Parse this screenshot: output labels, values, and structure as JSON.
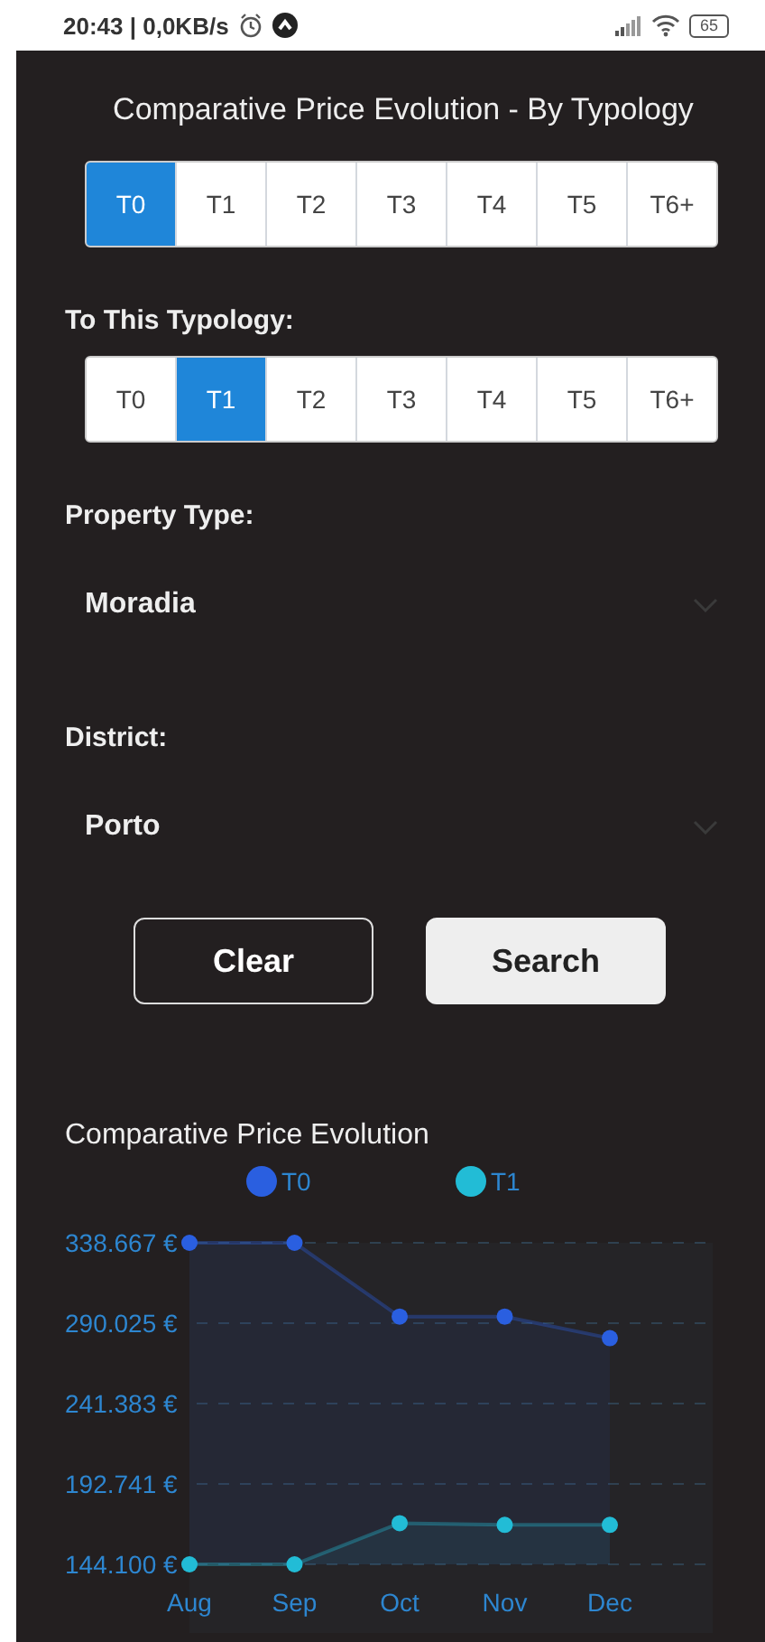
{
  "status_bar": {
    "text": "20:43 | 0,0KB/s",
    "battery": "65"
  },
  "title": "Comparative Price Evolution - By Typology",
  "from_typology": {
    "options": [
      {
        "label": "T0",
        "selected": true
      },
      {
        "label": "T1",
        "selected": false
      },
      {
        "label": "T2",
        "selected": false
      },
      {
        "label": "T3",
        "selected": false
      },
      {
        "label": "T4",
        "selected": false
      },
      {
        "label": "T5",
        "selected": false
      },
      {
        "label": "T6+",
        "selected": false
      }
    ]
  },
  "to_typology": {
    "label": "To This Typology:",
    "options": [
      {
        "label": "T0",
        "selected": false
      },
      {
        "label": "T1",
        "selected": true
      },
      {
        "label": "T2",
        "selected": false
      },
      {
        "label": "T3",
        "selected": false
      },
      {
        "label": "T4",
        "selected": false
      },
      {
        "label": "T5",
        "selected": false
      },
      {
        "label": "T6+",
        "selected": false
      }
    ]
  },
  "property_type": {
    "label": "Property Type:",
    "value": "Moradia"
  },
  "district": {
    "label": "District:",
    "value": "Porto"
  },
  "buttons": [
    {
      "label": "Clear",
      "kind": "outline"
    },
    {
      "label": "Search",
      "kind": "filled"
    }
  ],
  "chart": {
    "title": "Comparative Price Evolution",
    "chart_data": {
      "type": "area",
      "categories": [
        "Aug",
        "Sep",
        "Oct",
        "Nov",
        "Dec"
      ],
      "series": [
        {
          "name": "T0",
          "color": "#2a5fe0",
          "values": [
            338667,
            338667,
            294000,
            294000,
            281000
          ]
        },
        {
          "name": "T1",
          "color": "#22bcd6",
          "values": [
            144100,
            144100,
            169000,
            168000,
            168000
          ]
        }
      ],
      "ylim": [
        144100,
        338667
      ],
      "grid": true,
      "legend": true,
      "yticks": [
        {
          "value": 338667,
          "label": "338.667 €"
        },
        {
          "value": 290025,
          "label": "290.025 €"
        },
        {
          "value": 241383,
          "label": "241.383 €"
        },
        {
          "value": 192741,
          "label": "192.741 €"
        },
        {
          "value": 144100,
          "label": "144.100 €"
        }
      ]
    }
  }
}
